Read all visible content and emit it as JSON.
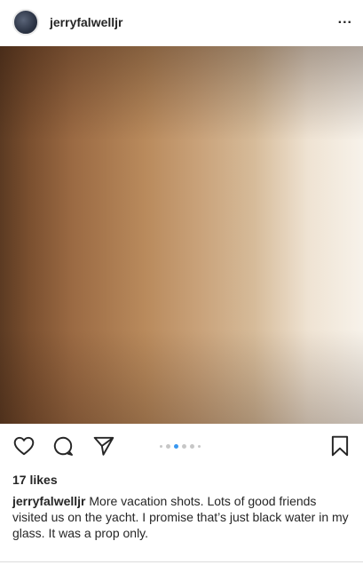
{
  "header": {
    "username": "jerryfalwelljr",
    "more_label": "...",
    "avatar_icon": "profile-avatar"
  },
  "photo": {
    "icon": "photo-placeholder"
  },
  "actions": {
    "like_icon": "heart-icon",
    "comment_icon": "comment-icon",
    "share_icon": "send-icon",
    "save_icon": "bookmark-icon",
    "carousel_current": 2,
    "carousel_dots": 6,
    "accent_color": "#3897f0"
  },
  "likes": {
    "label": "17 likes"
  },
  "caption": {
    "username": "jerryfalwelljr",
    "text": "More vacation shots.  Lots of good friends visited us on the yacht.  I promise that’s just black water in my glass.  It was a prop only."
  }
}
